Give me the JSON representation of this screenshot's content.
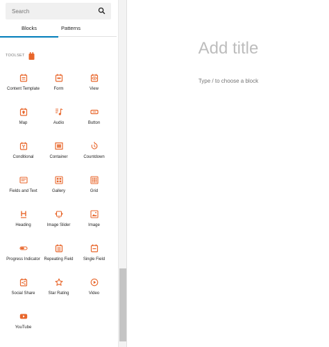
{
  "sidebar": {
    "search": {
      "placeholder": "Search",
      "value": ""
    },
    "tabs": [
      {
        "label": "Blocks",
        "active": true
      },
      {
        "label": "Patterns",
        "active": false
      }
    ],
    "section": {
      "title": "TOOLSET"
    },
    "blocks": [
      {
        "label": "Content Template",
        "icon": "content-template-icon"
      },
      {
        "label": "Form",
        "icon": "form-icon"
      },
      {
        "label": "View",
        "icon": "view-icon"
      },
      {
        "label": "Map",
        "icon": "map-icon"
      },
      {
        "label": "Audio",
        "icon": "audio-icon"
      },
      {
        "label": "Button",
        "icon": "button-icon"
      },
      {
        "label": "Conditional",
        "icon": "conditional-icon"
      },
      {
        "label": "Container",
        "icon": "container-icon"
      },
      {
        "label": "Countdown",
        "icon": "countdown-icon"
      },
      {
        "label": "Fields and Text",
        "icon": "fields-and-text-icon"
      },
      {
        "label": "Gallery",
        "icon": "gallery-icon"
      },
      {
        "label": "Grid",
        "icon": "grid-icon"
      },
      {
        "label": "Heading",
        "icon": "heading-icon"
      },
      {
        "label": "Image Slider",
        "icon": "image-slider-icon"
      },
      {
        "label": "Image",
        "icon": "image-icon"
      },
      {
        "label": "Progress Indicator",
        "icon": "progress-indicator-icon"
      },
      {
        "label": "Repeating Field",
        "icon": "repeating-field-icon"
      },
      {
        "label": "Single Field",
        "icon": "single-field-icon"
      },
      {
        "label": "Social Share",
        "icon": "social-share-icon"
      },
      {
        "label": "Star Rating",
        "icon": "star-rating-icon"
      },
      {
        "label": "Video",
        "icon": "video-icon"
      },
      {
        "label": "YouTube",
        "icon": "youtube-icon"
      }
    ]
  },
  "editor": {
    "title_placeholder": "Add title",
    "block_prompt": "Type / to choose a block"
  },
  "colors": {
    "icon_accent": "#e8662b",
    "tab_indicator": "#007cba"
  }
}
